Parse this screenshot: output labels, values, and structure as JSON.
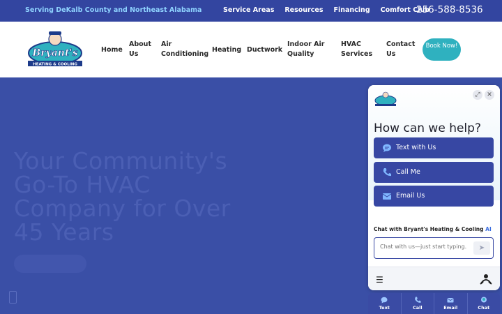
{
  "topbar": {
    "tagline": "Serving DeKalb County and Northeast Alabama",
    "links": [
      "Service Areas",
      "Resources",
      "Financing",
      "Comfort Club"
    ],
    "phone": "256-588-8536"
  },
  "logo": {
    "name": "Bryant's",
    "sub": "HEATING & COOLING"
  },
  "nav": {
    "items": [
      "Home",
      "About Us",
      "Air Conditioning",
      "Heating",
      "Ductwork",
      "Indoor Air Quality",
      "HVAC Services",
      "Contact Us"
    ],
    "cta": "Book Now!"
  },
  "hero": {
    "title": "Your Community's Go-To HVAC Company for Over 45 Years"
  },
  "widget": {
    "heading": "How can we help?",
    "options": [
      {
        "label": "Text with Us",
        "icon": "chat-bubble-icon"
      },
      {
        "label": "Call Me",
        "icon": "phone-icon"
      },
      {
        "label": "Email Us",
        "icon": "mail-icon"
      }
    ],
    "chat_with": "Chat with Bryant's Heating & Cooling",
    "ai_badge": "AI",
    "input_placeholder": "Chat with us—just start typing."
  },
  "tabbar": {
    "tabs": [
      {
        "label": "Text",
        "icon": "chat-bubble-icon"
      },
      {
        "label": "Call",
        "icon": "phone-icon"
      },
      {
        "label": "Email",
        "icon": "mail-icon"
      },
      {
        "label": "Chat",
        "icon": "bot-icon"
      }
    ]
  },
  "colors": {
    "brand_blue": "#3345a0",
    "accent_teal": "#2fb1bf",
    "link_blue": "#8fd3ff"
  }
}
